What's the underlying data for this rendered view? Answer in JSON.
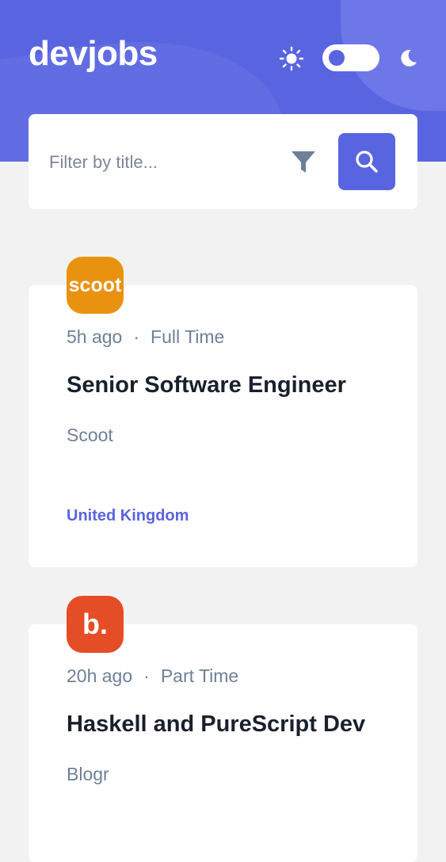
{
  "header": {
    "logo": "devjobs",
    "theme": {
      "mode": "light"
    }
  },
  "search": {
    "placeholder": "Filter by title..."
  },
  "jobs": [
    {
      "posted": "5h ago",
      "contract": "Full Time",
      "title": "Senior Software Engineer",
      "company": "Scoot",
      "location": "United Kingdom",
      "logo_text": "scoot",
      "logo_color": "#e99210"
    },
    {
      "posted": "20h ago",
      "contract": "Part Time",
      "title": "Haskell and PureScript Dev",
      "company": "Blogr",
      "location": "",
      "logo_text": "b.",
      "logo_color": "#e54d26"
    }
  ],
  "colors": {
    "accent": "#5964e0",
    "background": "#f2f2f2",
    "text_dark": "#19202d",
    "text_muted": "#6e8098"
  }
}
